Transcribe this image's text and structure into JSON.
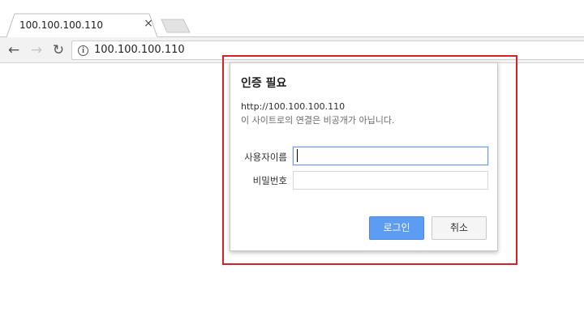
{
  "browser": {
    "tab": {
      "title": "100.100.100.110",
      "close_glyph": "×"
    },
    "toolbar": {
      "back_glyph": "←",
      "forward_glyph": "→",
      "reload_glyph": "↻",
      "info_glyph": "i",
      "url": "100.100.100.110"
    }
  },
  "auth_dialog": {
    "title": "인증 필요",
    "origin": "http://100.100.100.110",
    "warning": "이 사이트로의 연결은 비공개가 아닙니다.",
    "username_label": "사용자이름",
    "username_value": "",
    "password_label": "비밀번호",
    "password_value": "",
    "login_button": "로그인",
    "cancel_button": "취소"
  },
  "colors": {
    "highlight": "#d61f26",
    "login_button": "#5c9cf2",
    "focus_border": "#6f9ee8"
  }
}
